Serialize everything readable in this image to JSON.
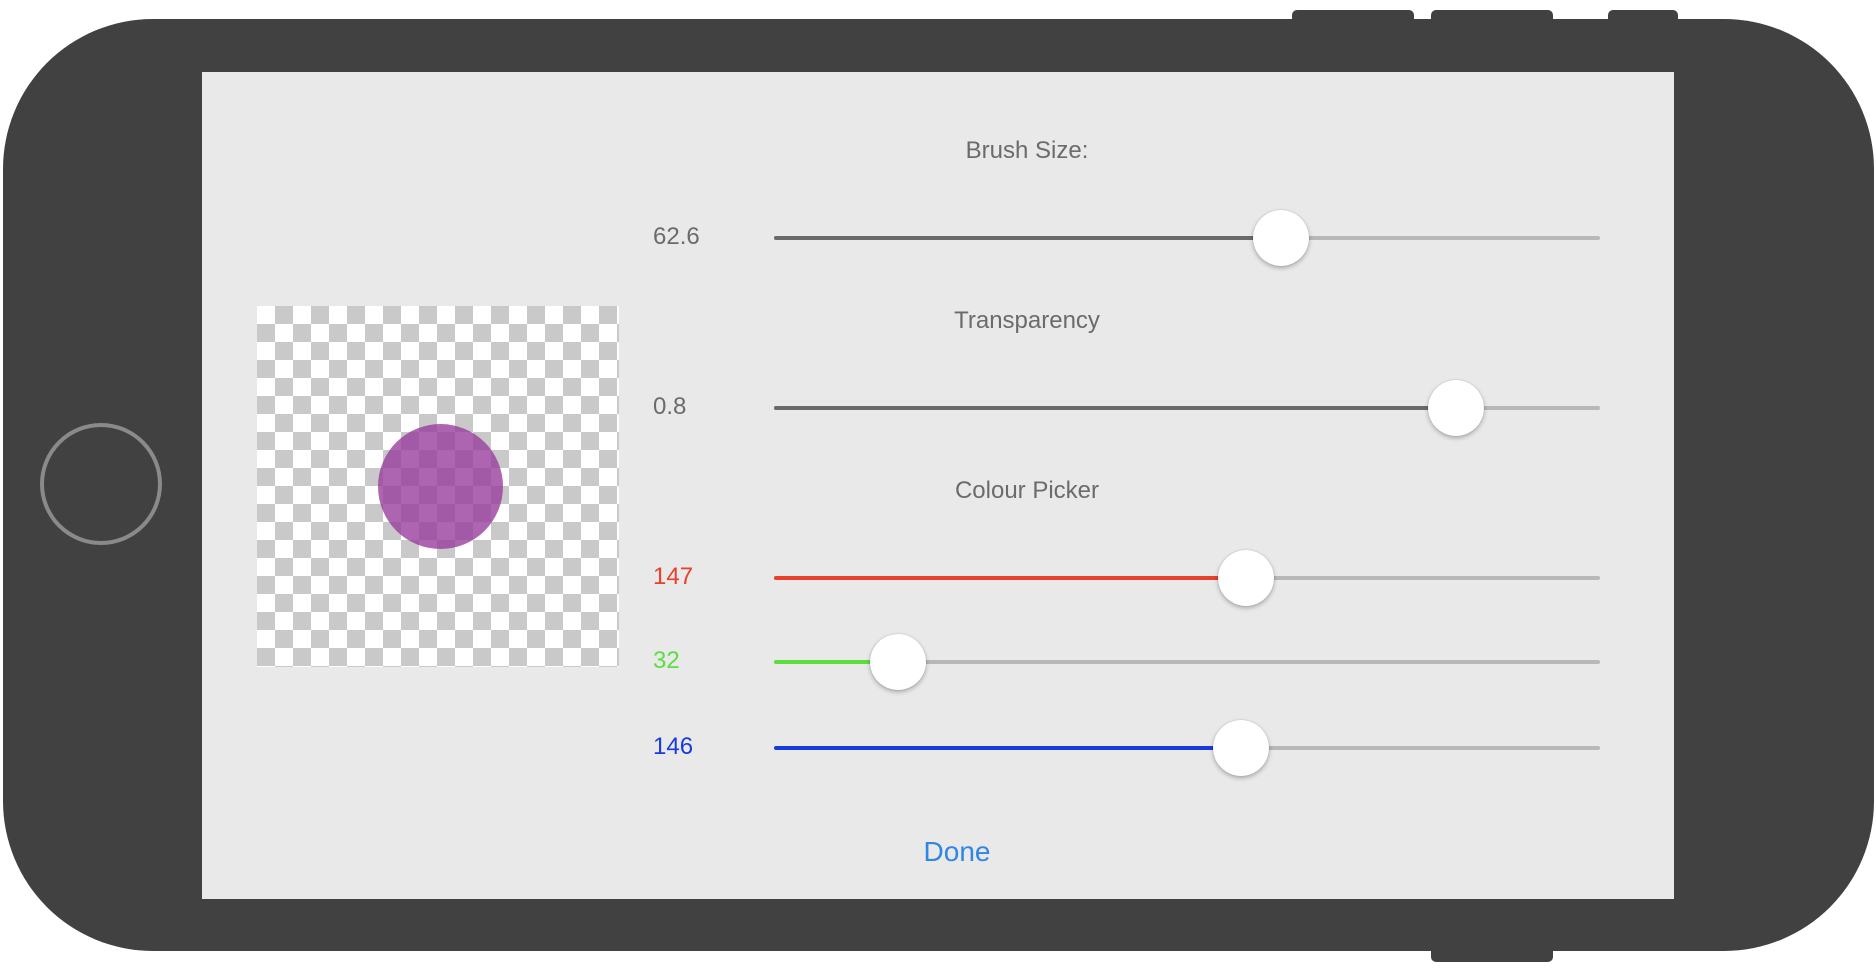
{
  "colors": {
    "device_frame": "#414141",
    "screen_background": "#e9e9e9",
    "label_gray": "#6b6b6b",
    "track_fill_gray": "#6a6a6a",
    "track_empty": "#b8b8b8",
    "red": "#e8402a",
    "green": "#5bdf3e",
    "blue": "#1a3bdc",
    "done_blue": "#2f86e3",
    "brush_preview": "#9a3f9d"
  },
  "preview": {
    "icon": "transparency-checkerboard",
    "brush": "brush-preview-dot"
  },
  "brush_size": {
    "title": "Brush Size:",
    "value_label": "62.6",
    "fraction": 0.614
  },
  "transparency": {
    "title": "Transparency",
    "value_label": "0.8",
    "fraction": 0.826
  },
  "colour_picker": {
    "title": "Colour Picker",
    "red": {
      "value_label": "147",
      "fraction": 0.572
    },
    "green": {
      "value_label": "32",
      "fraction": 0.15
    },
    "blue": {
      "value_label": "146",
      "fraction": 0.565
    }
  },
  "done_label": "Done"
}
